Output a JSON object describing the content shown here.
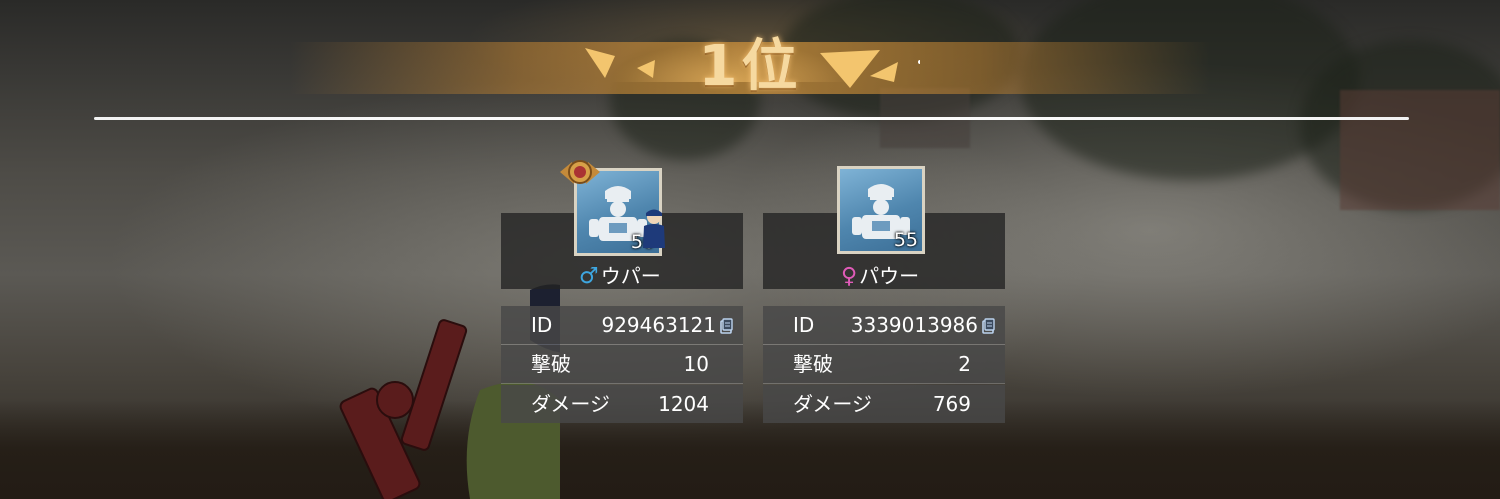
{
  "result": {
    "rank_label": "1位"
  },
  "players": [
    {
      "name": "ウパー",
      "gender_symbol": "♂",
      "gender_color": "#3ea6e0",
      "level": "50",
      "has_rank_badge": true,
      "badge_icon": "rank-badge-icon",
      "stats": {
        "id_label": "ID",
        "id_value": "929463121",
        "kills_label": "撃破",
        "kills_value": "10",
        "damage_label": "ダメージ",
        "damage_value": "1204"
      }
    },
    {
      "name": "パウー",
      "gender_symbol": "♀",
      "gender_color": "#e05bb8",
      "level": "55",
      "has_rank_badge": false,
      "stats": {
        "id_label": "ID",
        "id_value": "3339013986",
        "kills_label": "撃破",
        "kills_value": "2",
        "damage_label": "ダメージ",
        "damage_value": "769"
      }
    }
  ],
  "colors": {
    "banner_gold": "#d4a055",
    "rank_text": "#f6d9a0",
    "card_bg": "#222222",
    "stat_bg": "#484848"
  }
}
